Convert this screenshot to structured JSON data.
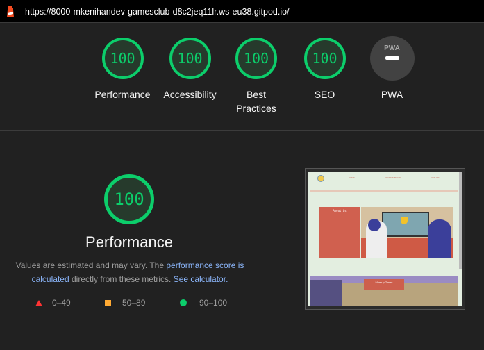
{
  "topbar": {
    "url": "https://8000-mkenihandev-gamesclub-d8c2jeq11lr.ws-eu38.gitpod.io/",
    "icon": "lighthouse-icon"
  },
  "gauges": [
    {
      "label": "Performance",
      "score": "100"
    },
    {
      "label": "Accessibility",
      "score": "100"
    },
    {
      "label": "Best Practices",
      "score": "100"
    },
    {
      "label": "SEO",
      "score": "100"
    },
    {
      "label": "PWA",
      "badge": "PWA"
    }
  ],
  "performance": {
    "score": "100",
    "title": "Performance",
    "desc_prefix": "Values are estimated and may vary. The ",
    "link1": "performance score is calculated",
    "desc_mid": " directly from these metrics. ",
    "link2": "See calculator."
  },
  "legend": [
    {
      "range": "0–49",
      "color": "#ff3333",
      "shape": "triangle"
    },
    {
      "range": "50–89",
      "color": "#ffaa33",
      "shape": "square"
    },
    {
      "range": "90–100",
      "color": "#0cce6b",
      "shape": "circle"
    }
  ],
  "screenshot": {
    "nav": [
      "HOME",
      "TOURNAMENTS",
      "SIGN UP"
    ],
    "about_title": "About Us",
    "meetup_title": "Meetup Times"
  },
  "colors": {
    "pass": "#0cce6b",
    "bg": "#212121"
  }
}
